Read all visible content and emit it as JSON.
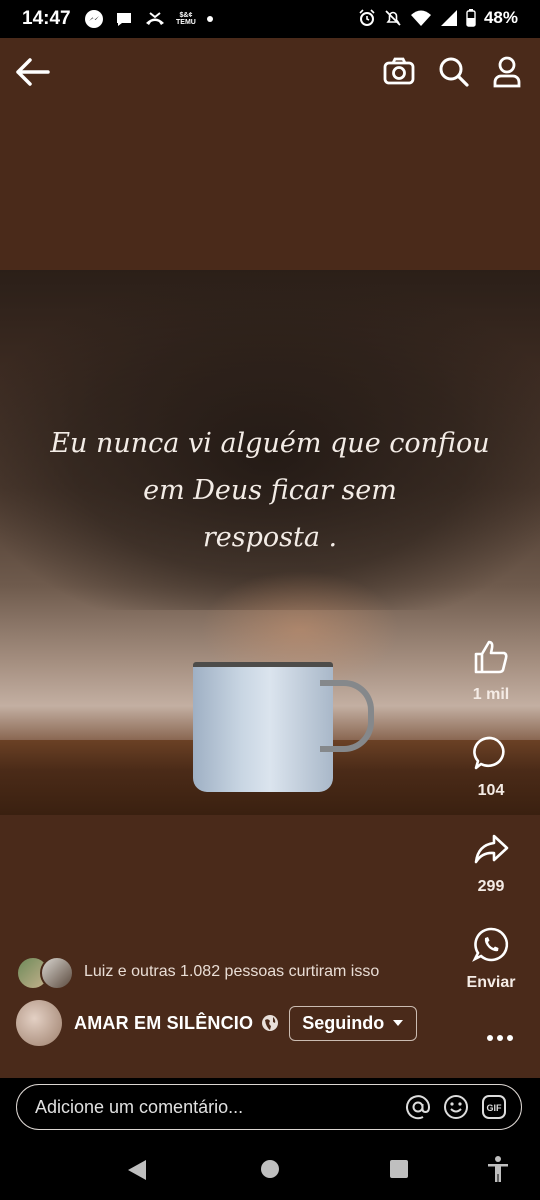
{
  "status_bar": {
    "time": "14:47",
    "battery": "48%",
    "left_icons": [
      "messenger-icon",
      "chat-bubble-icon",
      "missed-call-icon",
      "temu-icon",
      "dot-icon"
    ],
    "right_icons": [
      "alarm-icon",
      "mute-icon",
      "wifi-icon",
      "signal-icon",
      "battery-icon"
    ],
    "temu_label_top": "$&¢",
    "temu_label_bottom": "TEMU"
  },
  "top_bar": {
    "icons": [
      "back-arrow-icon",
      "camera-icon",
      "search-icon",
      "profile-icon"
    ]
  },
  "post": {
    "quote_lines": [
      "Eu nunca vi alguém que confiou",
      "em Deus ficar sem",
      "resposta ."
    ]
  },
  "actions": {
    "like_count": "1 mil",
    "comment_count": "104",
    "share_count": "299",
    "send_label": "Enviar"
  },
  "reactions": {
    "text": "Luiz e outras 1.082 pessoas curtiram isso"
  },
  "page": {
    "name": "AMAR EM SILÊNCIO",
    "follow_label": "Seguindo"
  },
  "comment": {
    "placeholder": "Adicione um comentário..."
  },
  "colors": {
    "background": "#4a2a1a",
    "bottom_bar": "#000000",
    "text": "#ffffff"
  }
}
